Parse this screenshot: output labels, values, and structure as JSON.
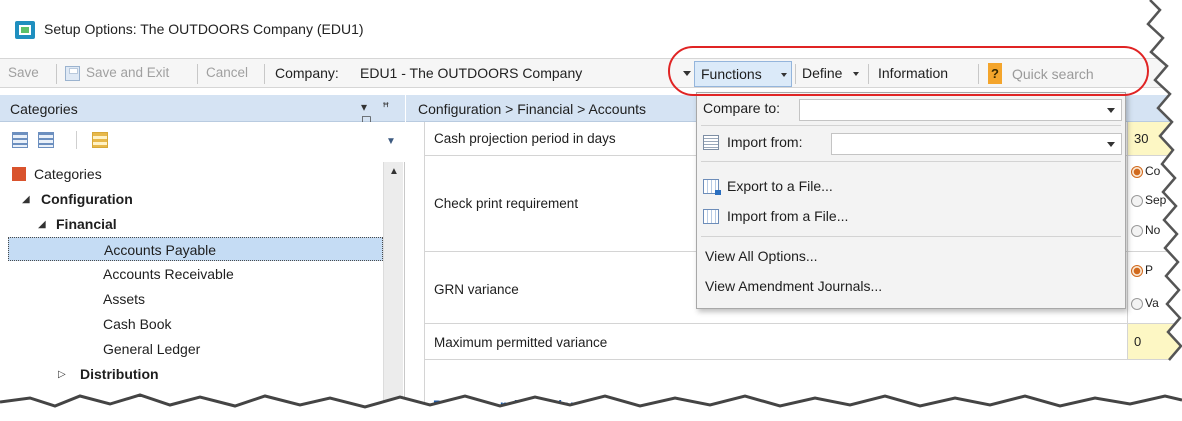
{
  "window": {
    "title": "Setup Options: The OUTDOORS Company (EDU1)"
  },
  "toolbar": {
    "save": "Save",
    "save_and_exit": "Save and Exit",
    "cancel": "Cancel",
    "company_label": "Company:",
    "company_value": "EDU1 - The OUTDOORS Company",
    "functions": "Functions",
    "define": "Define",
    "information": "Information",
    "help": "?",
    "search_placeholder": "Quick search"
  },
  "categories_panel": {
    "title": "Categories",
    "tree": [
      {
        "label": "Categories",
        "level": 0
      },
      {
        "label": "Configuration",
        "level": 1,
        "bold": true,
        "expanded": true
      },
      {
        "label": "Financial",
        "level": 2,
        "bold": true,
        "expanded": true
      },
      {
        "label": "Accounts Payable",
        "level": 3,
        "selected": true
      },
      {
        "label": "Accounts Receivable",
        "level": 3
      },
      {
        "label": "Assets",
        "level": 3
      },
      {
        "label": "Cash Book",
        "level": 3
      },
      {
        "label": "General Ledger",
        "level": 3
      },
      {
        "label": "Distribution",
        "level": 2,
        "bold": true,
        "expanded": false
      }
    ]
  },
  "content": {
    "breadcrumb": "Configuration > Financial > Accounts",
    "rows": [
      {
        "label": "Cash projection period in days",
        "value": "30"
      },
      {
        "label": "Check print requirement",
        "options": [
          "Co",
          "Sep",
          "No"
        ],
        "selected_option": "Co"
      },
      {
        "label": "GRN variance",
        "options": [
          "P",
          "Va"
        ],
        "selected_option": "P"
      },
      {
        "label": "Maximum permitted variance",
        "value": "0"
      }
    ],
    "section": "Purchase price variance"
  },
  "functions_menu": {
    "compare_to": "Compare to:",
    "import_from": "Import from:",
    "export_to_file": "Export to a File...",
    "import_from_file": "Import from a File...",
    "view_all_options": "View All Options...",
    "view_amendment_journals": "View Amendment Journals..."
  },
  "colors": {
    "header_blue": "#d5e3f3",
    "selected_row": "#c5dcf4",
    "value_cell": "#fdf7c4",
    "highlight_ring": "#e02424",
    "section_link": "#1c5aa6",
    "help_button": "#f4a52c"
  }
}
